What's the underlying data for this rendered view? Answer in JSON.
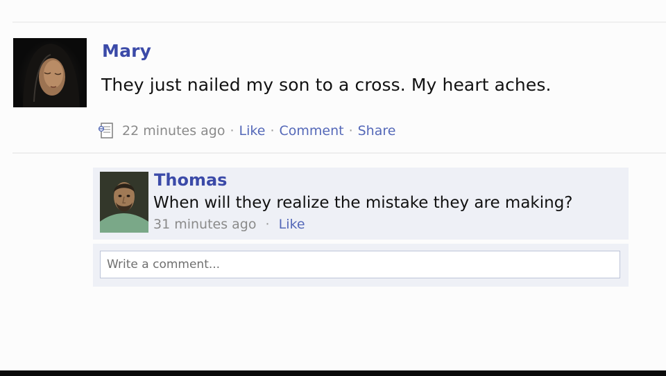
{
  "post": {
    "author": "Mary",
    "text": "They just nailed my son to a cross. My heart aches.",
    "time": "22 minutes ago",
    "actions": {
      "like": "Like",
      "comment": "Comment",
      "share": "Share"
    },
    "separator": "·"
  },
  "comment": {
    "author": "Thomas",
    "text": "When will they realize the mistake they are making?",
    "time": "31 minutes ago",
    "like": "Like",
    "separator": "·"
  },
  "composer": {
    "placeholder": "Write a comment..."
  },
  "colors": {
    "link": "#3b4aa8",
    "meta_link": "#5468b8",
    "comment_bg": "#eef0f6"
  }
}
